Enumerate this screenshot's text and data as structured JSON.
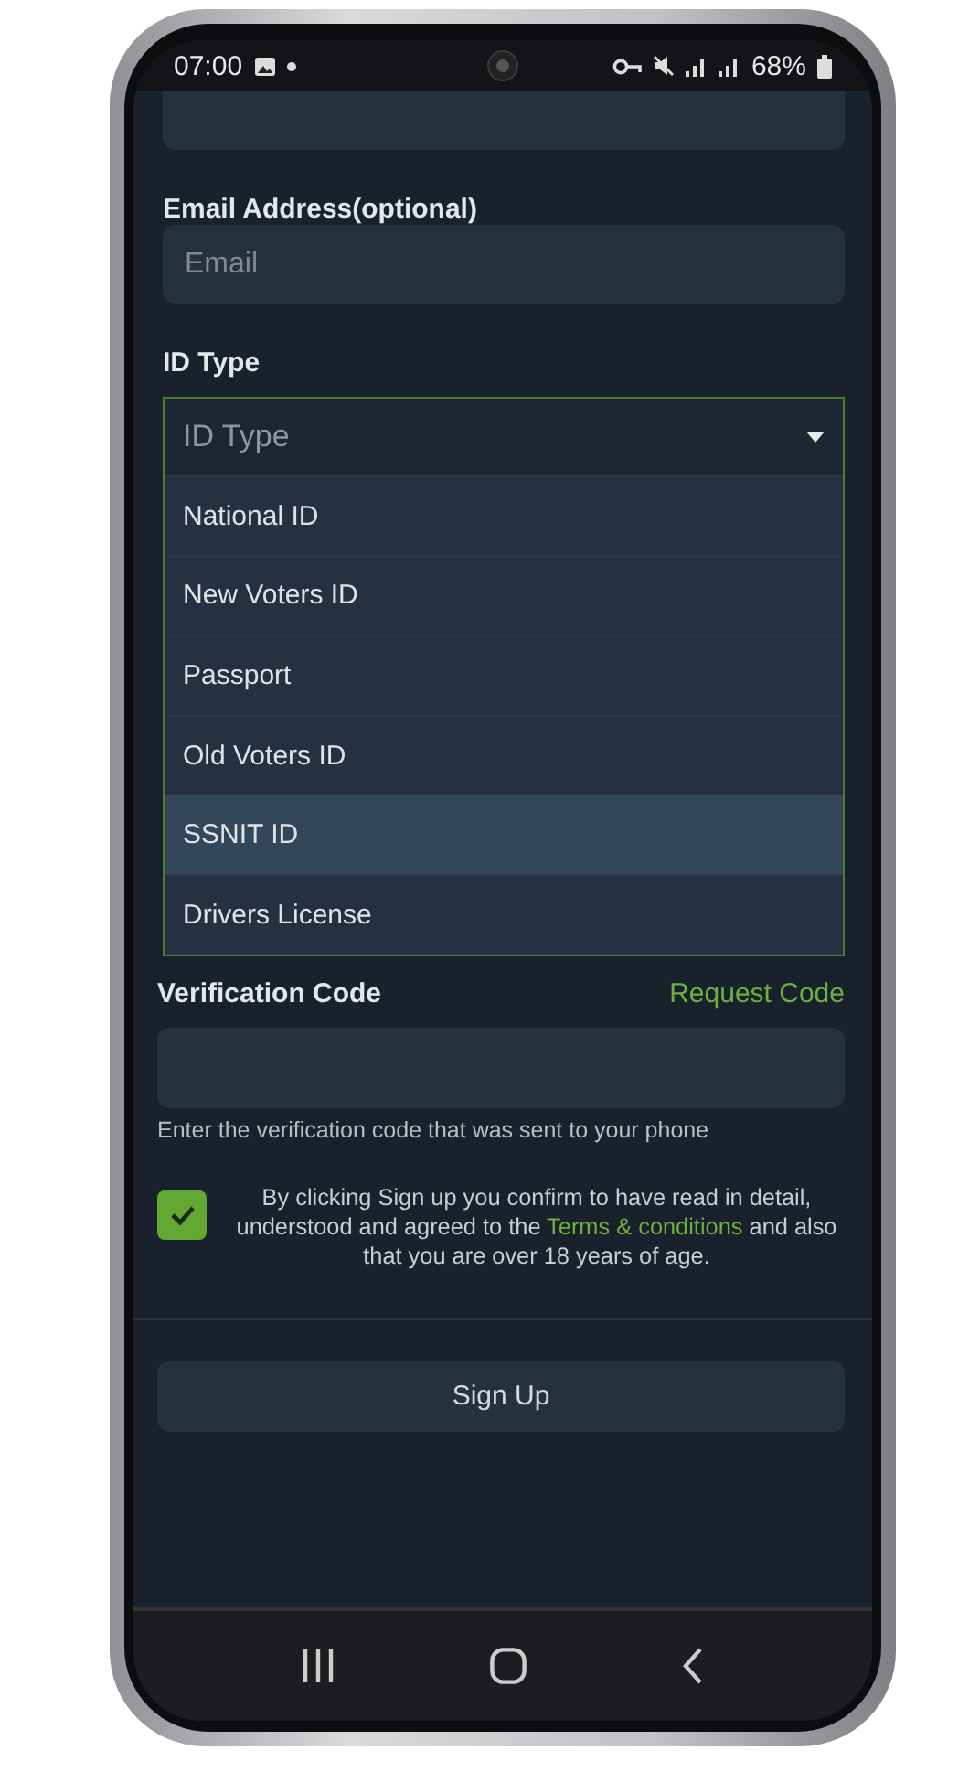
{
  "status_bar": {
    "time": "07:00",
    "battery": "68%"
  },
  "form": {
    "email": {
      "label": "Email Address(optional)",
      "placeholder": "Email"
    },
    "id_type": {
      "label": "ID Type",
      "placeholder": "ID Type",
      "expanded": true,
      "options": [
        {
          "label": "National ID",
          "selected": false
        },
        {
          "label": "New Voters ID",
          "selected": false
        },
        {
          "label": "Passport",
          "selected": false
        },
        {
          "label": "Old Voters ID",
          "selected": false
        },
        {
          "label": "SSNIT ID",
          "selected": true
        },
        {
          "label": "Drivers License",
          "selected": false
        }
      ]
    },
    "verification": {
      "label": "Verification Code",
      "request_link": "Request Code",
      "hint": "Enter the verification code that was sent to your phone"
    },
    "terms": {
      "checked": true,
      "text_before": "By clicking Sign up you confirm to have read in detail, understood and agreed to the",
      "link": "Terms & conditions",
      "text_after": "and also that you are over 18 years of age."
    },
    "sign_up_button": "Sign Up"
  }
}
